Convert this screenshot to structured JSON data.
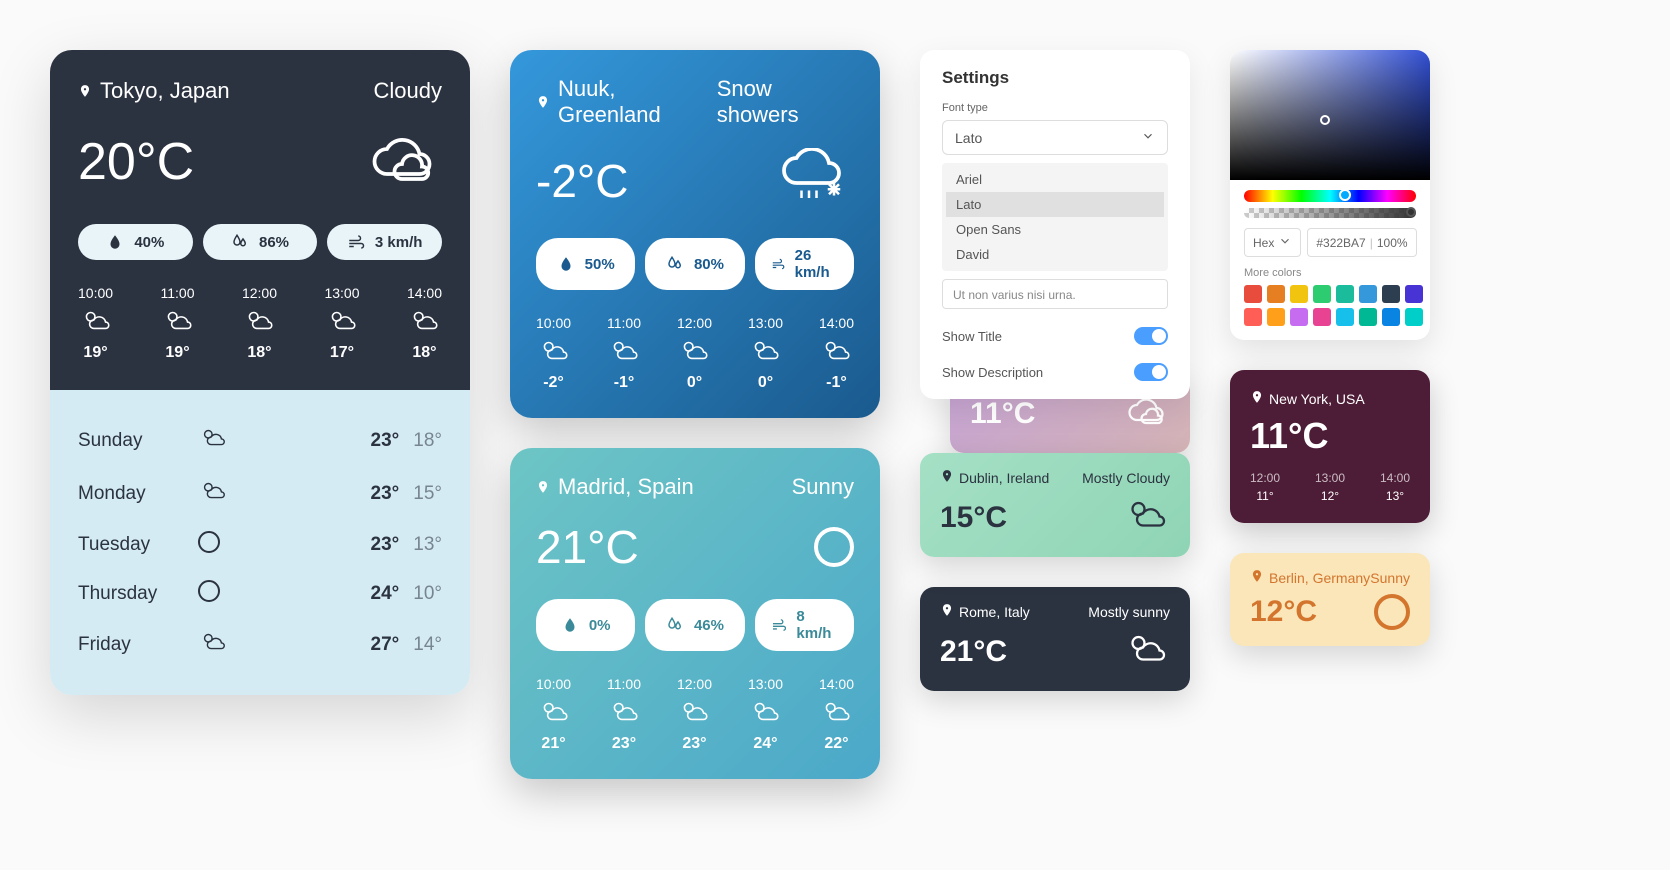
{
  "tokyo": {
    "location": "Tokyo, Japan",
    "condition": "Cloudy",
    "temp": "20°C",
    "precip": "40%",
    "humidity": "86%",
    "wind": "3 km/h",
    "hours": [
      {
        "t": "10:00",
        "temp": "19°"
      },
      {
        "t": "11:00",
        "temp": "19°"
      },
      {
        "t": "12:00",
        "temp": "18°"
      },
      {
        "t": "13:00",
        "temp": "17°"
      },
      {
        "t": "14:00",
        "temp": "18°"
      }
    ],
    "days": [
      {
        "name": "Sunday",
        "hi": "23°",
        "lo": "18°"
      },
      {
        "name": "Monday",
        "hi": "23°",
        "lo": "15°"
      },
      {
        "name": "Tuesday",
        "hi": "23°",
        "lo": "13°"
      },
      {
        "name": "Thursday",
        "hi": "24°",
        "lo": "10°"
      },
      {
        "name": "Friday",
        "hi": "27°",
        "lo": "14°"
      }
    ]
  },
  "nuuk": {
    "location": "Nuuk, Greenland",
    "condition": "Snow showers",
    "temp": "-2°C",
    "precip": "50%",
    "humidity": "80%",
    "wind": "26 km/h",
    "hours": [
      {
        "t": "10:00",
        "temp": "-2°"
      },
      {
        "t": "11:00",
        "temp": "-1°"
      },
      {
        "t": "12:00",
        "temp": "0°"
      },
      {
        "t": "13:00",
        "temp": "0°"
      },
      {
        "t": "14:00",
        "temp": "-1°"
      }
    ]
  },
  "madrid": {
    "location": "Madrid, Spain",
    "condition": "Sunny",
    "temp": "21°C",
    "precip": "0%",
    "humidity": "46%",
    "wind": "8 km/h",
    "hours": [
      {
        "t": "10:00",
        "temp": "21°"
      },
      {
        "t": "11:00",
        "temp": "23°"
      },
      {
        "t": "12:00",
        "temp": "23°"
      },
      {
        "t": "13:00",
        "temp": "24°"
      },
      {
        "t": "14:00",
        "temp": "22°"
      }
    ]
  },
  "settings": {
    "title": "Settings",
    "font_label": "Font type",
    "font_value": "Lato",
    "options": [
      "Ariel",
      "Lato",
      "Open Sans",
      "David"
    ],
    "lorem": "Ut non varius nisi urna.",
    "show_title": "Show Title",
    "show_desc": "Show Description"
  },
  "dublin": {
    "location": "Dublin, Ireland",
    "condition": "Mostly Cloudy",
    "temp": "15°C"
  },
  "dublin_back": {
    "temp": "11°C"
  },
  "rome": {
    "location": "Rome, Italy",
    "condition": "Mostly sunny",
    "temp": "21°C"
  },
  "ny": {
    "location": "New York, USA",
    "temp": "11°C",
    "hours": [
      {
        "t": "12:00",
        "temp": "11°"
      },
      {
        "t": "13:00",
        "temp": "12°"
      },
      {
        "t": "14:00",
        "temp": "13°"
      }
    ]
  },
  "berlin": {
    "location": "Berlin, Germany",
    "condition": "Sunny",
    "temp": "12°C"
  },
  "picker": {
    "format": "Hex",
    "hex": "#322BA7",
    "opacity": "100%",
    "more_label": "More colors",
    "swatches": [
      "#e74c3c",
      "#e67e22",
      "#f1c40f",
      "#2ecc71",
      "#1abc9c",
      "#3498db",
      "#2c3e50",
      "#4834d4",
      "#ff5e57",
      "#ff9f1a",
      "#c56cf0",
      "#e84393",
      "#17c0eb",
      "#00b894",
      "#0984e3",
      "#00cec9"
    ]
  }
}
